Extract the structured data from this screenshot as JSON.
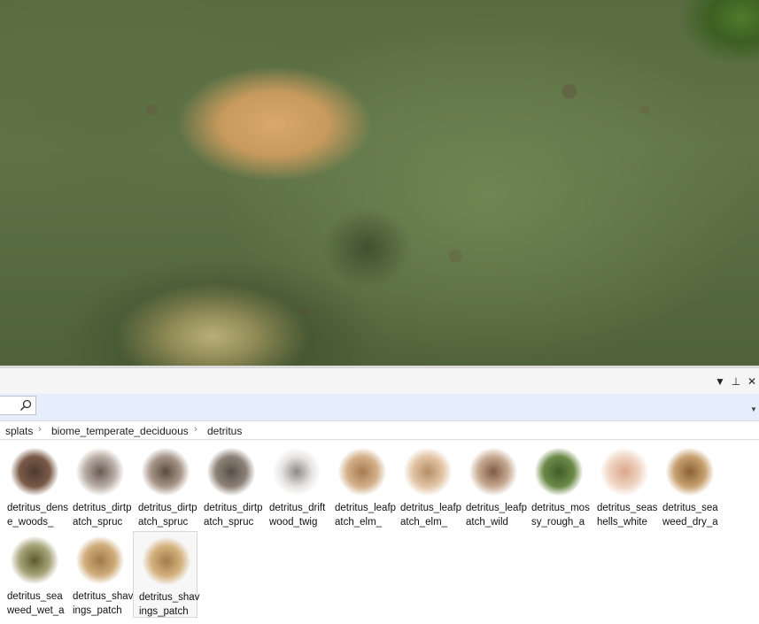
{
  "panel": {
    "header_buttons": [
      "dropdown-arrow",
      "pin",
      "close"
    ],
    "header_glyphs": {
      "dropdown": "▼",
      "pin": "⊥",
      "close": "✕"
    }
  },
  "search": {
    "value": "",
    "placeholder": ""
  },
  "breadcrumb": [
    "splats",
    "biome_temperate_deciduous",
    "detritus"
  ],
  "breadcrumb_separator": "›",
  "assets": [
    {
      "label": "detritus_dense_woods_",
      "thumb": [
        "#7a5a48",
        "#4e3a30"
      ]
    },
    {
      "label": "detritus_dirtpatch_spruc",
      "thumb": [
        "#b9aea6",
        "#6a5a52"
      ]
    },
    {
      "label": "detritus_dirtpatch_spruc",
      "thumb": [
        "#a8968a",
        "#5a4a40"
      ]
    },
    {
      "label": "detritus_dirtpatch_spruc",
      "thumb": [
        "#8e8278",
        "#5a5048"
      ]
    },
    {
      "label": "detritus_driftwood_twig",
      "thumb": [
        "#e6e4e2",
        "#8e8a86"
      ]
    },
    {
      "label": "detritus_leafpatch_elm_",
      "thumb": [
        "#d3b08a",
        "#a87a50"
      ]
    },
    {
      "label": "detritus_leafpatch_elm_",
      "thumb": [
        "#e2c4a4",
        "#b48e66"
      ]
    },
    {
      "label": "detritus_leafpatch_wild",
      "thumb": [
        "#c7aa92",
        "#7e5a44"
      ]
    },
    {
      "label": "detritus_mossy_rough_a",
      "thumb": [
        "#6c8a48",
        "#3e5e2a"
      ]
    },
    {
      "label": "detritus_seashells_white",
      "thumb": [
        "#f0d4c2",
        "#d9a88a"
      ]
    },
    {
      "label": "detritus_seaweed_dry_a",
      "thumb": [
        "#c7a070",
        "#8a6234"
      ]
    },
    {
      "label": "detritus_seaweed_wet_a",
      "thumb": [
        "#a6a47a",
        "#5e5a2e"
      ]
    },
    {
      "label": "detritus_shavings_patch",
      "thumb": [
        "#cfac7a",
        "#a07a48"
      ]
    },
    {
      "label": "detritus_shavings_patch",
      "thumb": [
        "#d4b27e",
        "#a27c4a"
      ],
      "selected": true
    }
  ]
}
